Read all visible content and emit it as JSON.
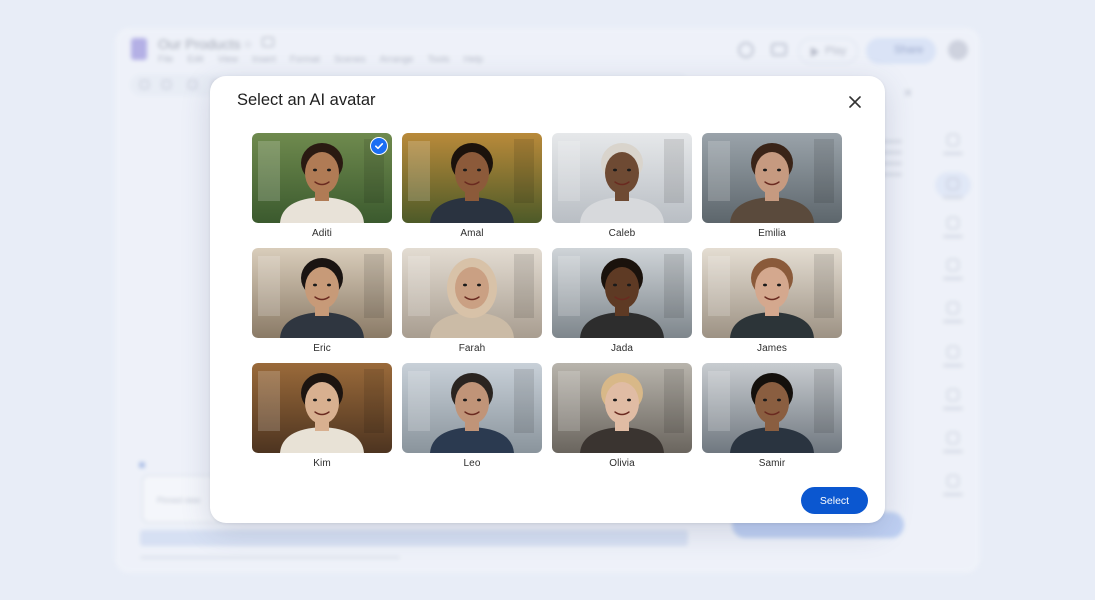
{
  "background_app": {
    "doc_title": "Our Products",
    "menu": [
      "File",
      "Edit",
      "View",
      "Insert",
      "Format",
      "Scenes",
      "Arrange",
      "Tools",
      "Help"
    ],
    "play_label": "Play",
    "share_label": "Share",
    "script_placeholder": "Pinned view"
  },
  "dialog": {
    "title": "Select an AI avatar",
    "close_icon": "close-icon",
    "select_label": "Select",
    "selected_index": 0,
    "accent_color": "#0b57d0",
    "avatars": [
      {
        "name": "Aditi"
      },
      {
        "name": "Amal"
      },
      {
        "name": "Caleb"
      },
      {
        "name": "Emilia"
      },
      {
        "name": "Eric"
      },
      {
        "name": "Farah"
      },
      {
        "name": "Jada"
      },
      {
        "name": "James"
      },
      {
        "name": "Kim"
      },
      {
        "name": "Leo"
      },
      {
        "name": "Olivia"
      },
      {
        "name": "Samir"
      }
    ]
  }
}
